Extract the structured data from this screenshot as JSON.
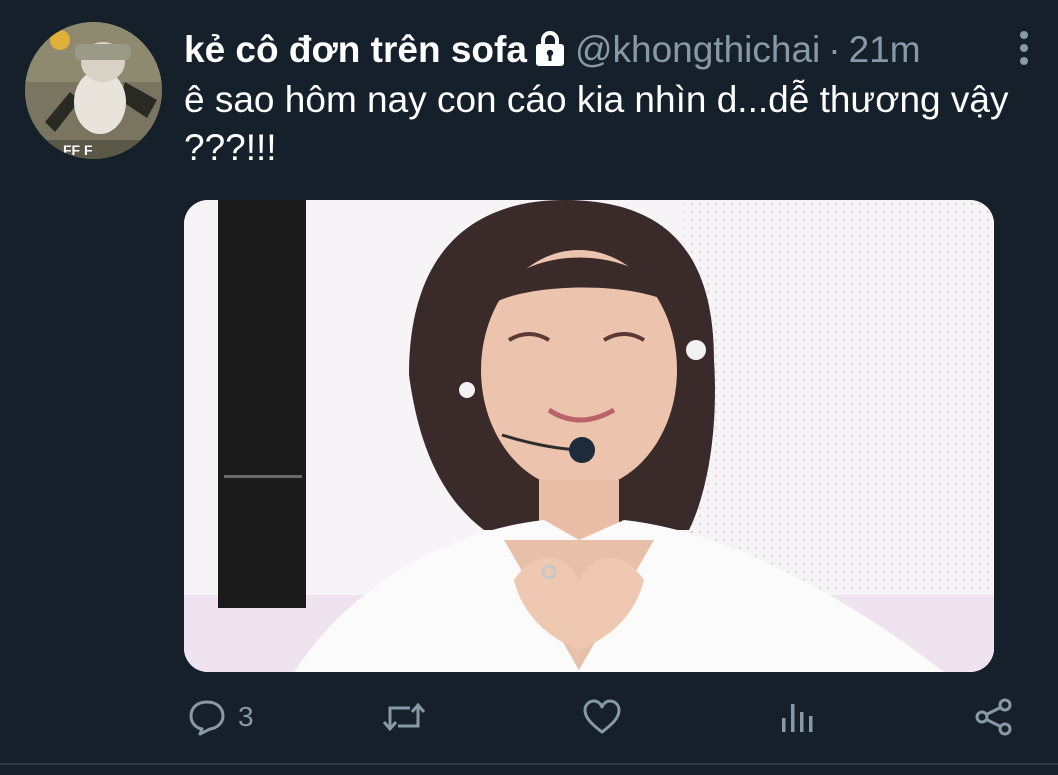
{
  "tweet": {
    "display_name": "kẻ cô đơn trên sofa",
    "handle": "@khongthichai",
    "separator": "·",
    "time": "21m",
    "text": "ê sao hôm nay con cáo kia nhìn d...dễ thương vậy ???!!!",
    "protected_icon": "lock-icon",
    "more_icon": "more-vertical-icon"
  },
  "actions": {
    "reply_icon": "reply-icon",
    "reply_count": "3",
    "retweet_icon": "retweet-icon",
    "like_icon": "heart-icon",
    "analytics_icon": "analytics-icon",
    "share_icon": "share-icon"
  },
  "colors": {
    "background": "#15202b",
    "secondary_text": "#8899a6",
    "primary_text": "#ffffff"
  }
}
